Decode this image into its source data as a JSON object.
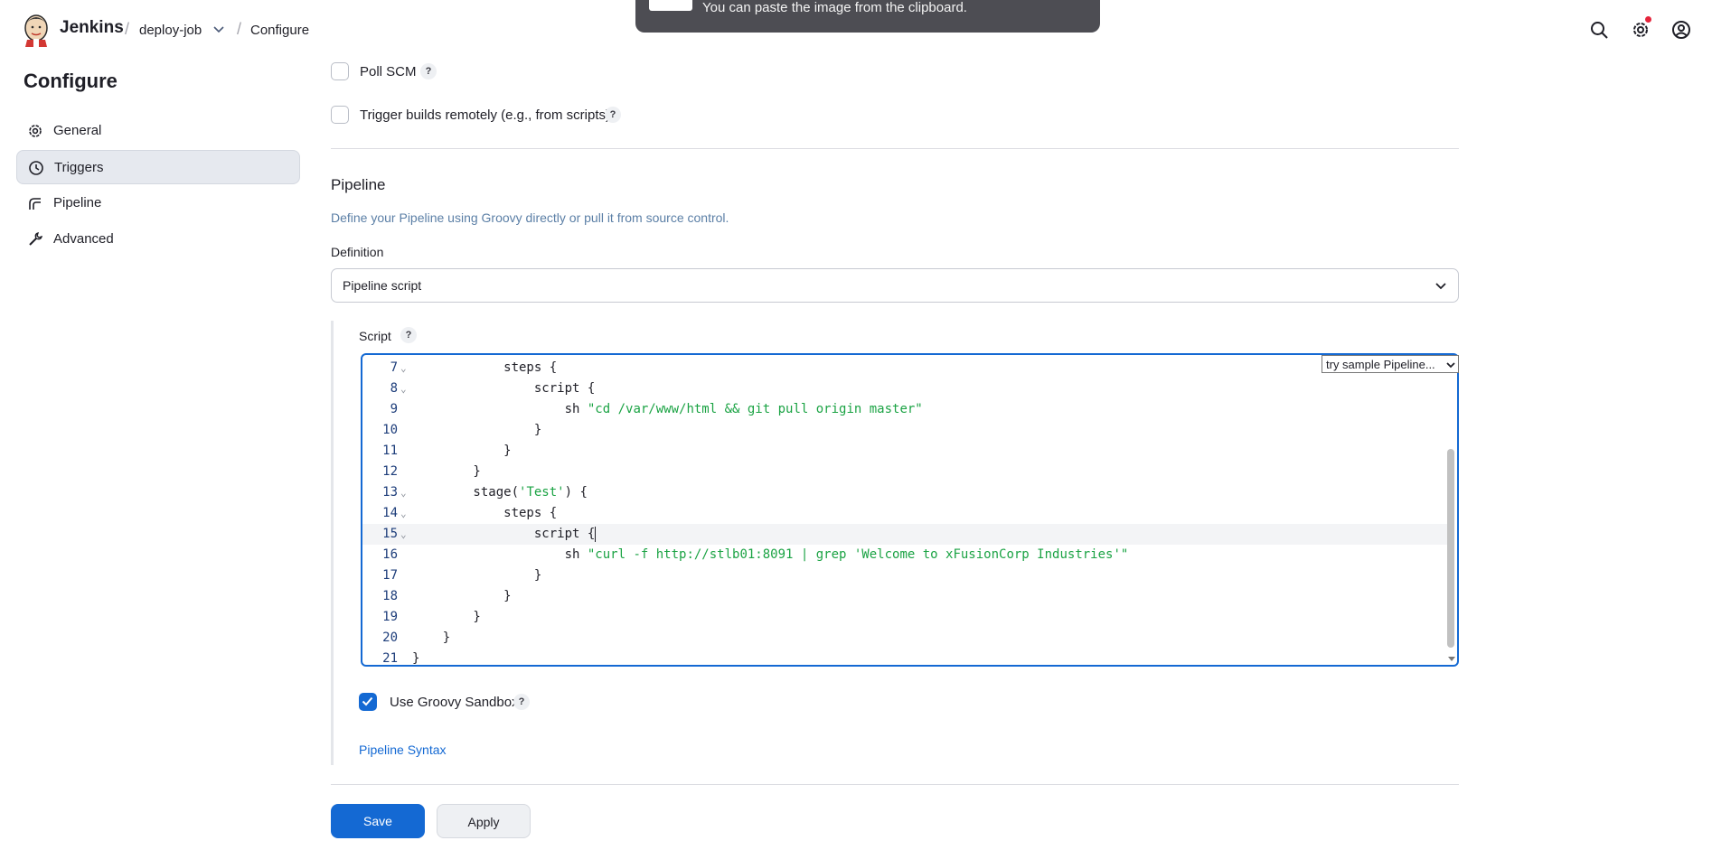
{
  "header": {
    "brand": "Jenkins",
    "breadcrumbs": [
      "deploy-job",
      "Configure"
    ],
    "separator": "/"
  },
  "toast": {
    "text": "You can paste the image from the clipboard."
  },
  "sidebar": {
    "title": "Configure",
    "items": [
      {
        "label": "General",
        "icon": "gear-icon",
        "active": false
      },
      {
        "label": "Triggers",
        "icon": "clock-icon",
        "active": true
      },
      {
        "label": "Pipeline",
        "icon": "pipeline-icon",
        "active": false
      },
      {
        "label": "Advanced",
        "icon": "wrench-icon",
        "active": false
      }
    ]
  },
  "triggers": {
    "poll_scm": {
      "label": "Poll SCM",
      "checked": false
    },
    "remote": {
      "label": "Trigger builds remotely (e.g., from scripts)",
      "checked": false
    }
  },
  "pipeline": {
    "title": "Pipeline",
    "description": "Define your Pipeline using Groovy directly or pull it from source control.",
    "definition_label": "Definition",
    "definition_value": "Pipeline script",
    "script_label": "Script",
    "sample_select": "try sample Pipeline...",
    "code_lines": [
      {
        "n": "7",
        "fold": true,
        "code": "            steps {"
      },
      {
        "n": "8",
        "fold": true,
        "code": "                script {"
      },
      {
        "n": "9",
        "fold": false,
        "code": "                    sh ",
        "str": "\"cd /var/www/html && git pull origin master\""
      },
      {
        "n": "10",
        "fold": false,
        "code": "                }"
      },
      {
        "n": "11",
        "fold": false,
        "code": "            }"
      },
      {
        "n": "12",
        "fold": false,
        "code": "        }"
      },
      {
        "n": "13",
        "fold": true,
        "code": "        stage(",
        "str": "'Test'",
        "after": ") {"
      },
      {
        "n": "14",
        "fold": true,
        "code": "            steps {"
      },
      {
        "n": "15",
        "fold": true,
        "code": "                script {",
        "current": true
      },
      {
        "n": "16",
        "fold": false,
        "code": "                    sh ",
        "str": "\"curl -f http://stlb01:8091 | grep 'Welcome to xFusionCorp Industries'\""
      },
      {
        "n": "17",
        "fold": false,
        "code": "                }"
      },
      {
        "n": "18",
        "fold": false,
        "code": "            }"
      },
      {
        "n": "19",
        "fold": false,
        "code": "        }"
      },
      {
        "n": "20",
        "fold": false,
        "code": "    }"
      },
      {
        "n": "21",
        "fold": false,
        "code": "}"
      }
    ],
    "sandbox": {
      "label": "Use Groovy Sandbox",
      "checked": true
    },
    "syntax_link": "Pipeline Syntax"
  },
  "buttons": {
    "save": "Save",
    "apply": "Apply"
  },
  "help_text": "?",
  "colors": {
    "accent": "#1469d3",
    "string": "#1ba344",
    "notification": "#e5243b"
  }
}
